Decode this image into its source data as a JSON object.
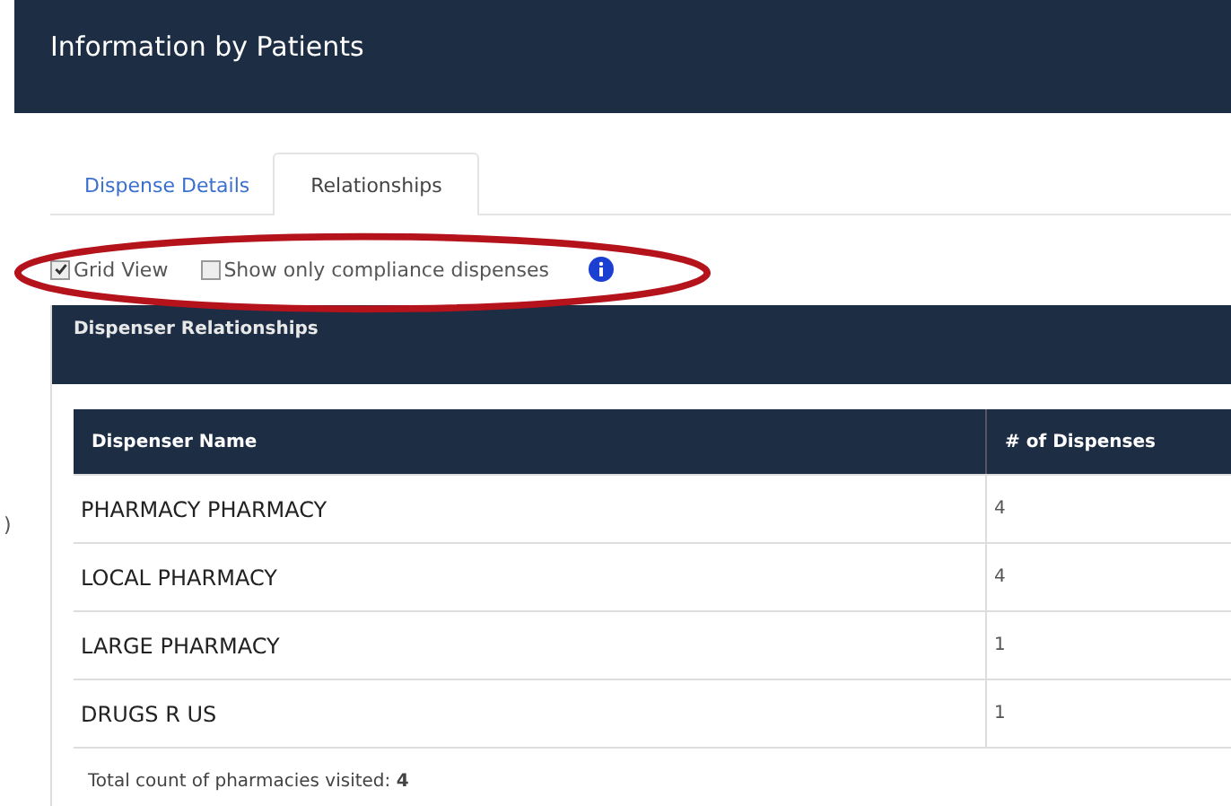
{
  "header": {
    "title": "Information by Patients"
  },
  "tabs": [
    {
      "label": "Dispense Details",
      "selected": false
    },
    {
      "label": "Relationships",
      "selected": true
    }
  ],
  "options": [
    {
      "label": "Grid View",
      "checked": true
    },
    {
      "label": "Show only compliance dispenses",
      "checked": false
    }
  ],
  "side_handle": ")",
  "annotation": {
    "kind": "ellipse"
  },
  "panel": {
    "title": "Dispenser Relationships"
  },
  "table": {
    "columns": [
      "Dispenser Name",
      "# of Dispenses"
    ],
    "rows": [
      [
        "PHARMACY PHARMACY",
        "4"
      ],
      [
        "LOCAL PHARMACY",
        "4"
      ],
      [
        "LARGE PHARMACY",
        "1"
      ],
      [
        "DRUGS R US",
        "1"
      ]
    ],
    "footer": "Total count of pharmacies visited: **4**"
  }
}
